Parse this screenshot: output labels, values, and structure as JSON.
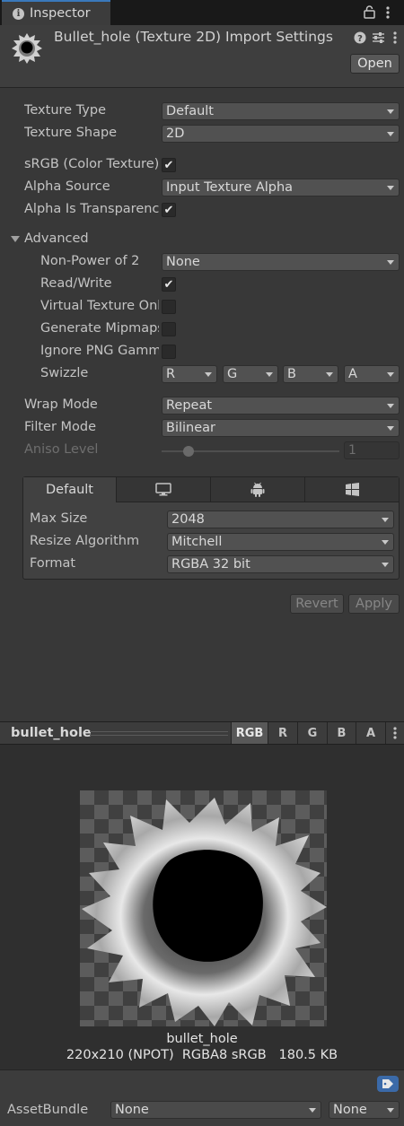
{
  "window": {
    "tab_label": "Inspector",
    "title": "Bullet_hole (Texture 2D) Import Settings",
    "open_label": "Open"
  },
  "fields": {
    "texture_type": {
      "label": "Texture Type",
      "value": "Default"
    },
    "texture_shape": {
      "label": "Texture Shape",
      "value": "2D"
    },
    "srgb": {
      "label": "sRGB (Color Texture)",
      "checked": true
    },
    "alpha_source": {
      "label": "Alpha Source",
      "value": "Input Texture Alpha"
    },
    "alpha_is_transparency": {
      "label": "Alpha Is Transparency",
      "checked": true
    }
  },
  "advanced": {
    "label": "Advanced",
    "npot": {
      "label": "Non-Power of 2",
      "value": "None"
    },
    "read_write": {
      "label": "Read/Write",
      "checked": true
    },
    "virtual_texture": {
      "label": "Virtual Texture Only",
      "checked": false
    },
    "generate_mipmaps": {
      "label": "Generate Mipmaps",
      "checked": false
    },
    "ignore_png_gamma": {
      "label": "Ignore PNG Gamma",
      "checked": false
    },
    "swizzle": {
      "label": "Swizzle",
      "values": [
        "R",
        "G",
        "B",
        "A"
      ]
    }
  },
  "wrap_mode": {
    "label": "Wrap Mode",
    "value": "Repeat"
  },
  "filter_mode": {
    "label": "Filter Mode",
    "value": "Bilinear"
  },
  "aniso_level": {
    "label": "Aniso Level",
    "value": "1",
    "level": 1,
    "max": 16
  },
  "platform": {
    "tabs": [
      {
        "label": "Default",
        "icon": ""
      },
      {
        "label": "",
        "icon": "monitor-icon"
      },
      {
        "label": "",
        "icon": "android-icon"
      },
      {
        "label": "",
        "icon": "windows-icon"
      }
    ],
    "max_size": {
      "label": "Max Size",
      "value": "2048"
    },
    "resize_algorithm": {
      "label": "Resize Algorithm",
      "value": "Mitchell"
    },
    "format": {
      "label": "Format",
      "value": "RGBA 32 bit"
    }
  },
  "actions": {
    "revert": "Revert",
    "apply": "Apply"
  },
  "preview": {
    "title": "bullet_hole",
    "channels": [
      "RGB",
      "R",
      "G",
      "B",
      "A"
    ],
    "active_channel": "RGB",
    "image_name": "bullet_hole",
    "image_info": "220x210 (NPOT)  RGBA8 sRGB   180.5 KB"
  },
  "asset_bundle": {
    "label": "AssetBundle",
    "name": "None",
    "variant": "None"
  },
  "colors": {
    "accent": "#3a79bb",
    "tag": "#3b6aa8",
    "background": "#383838"
  }
}
